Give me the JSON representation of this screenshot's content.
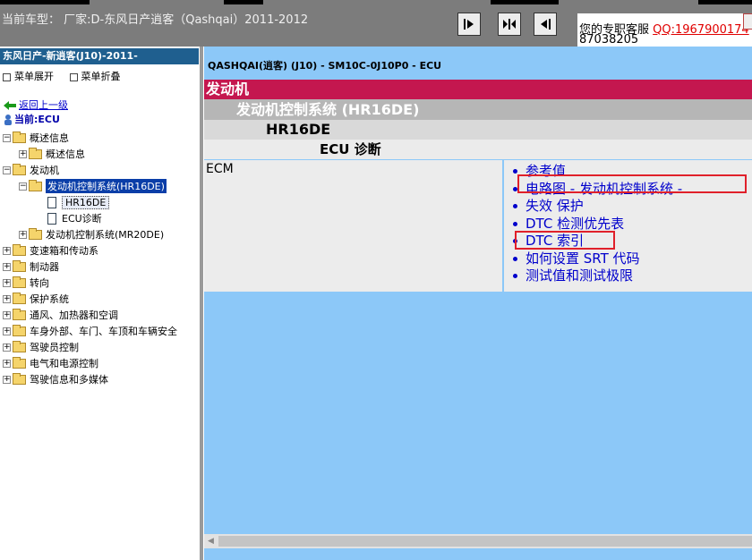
{
  "header": {
    "car_label": "当前车型： 厂家:D-东风日产逍客（Qashqai）2011-2012",
    "service_label": "您的专职客服 ",
    "service_qq": "QQ:1967900174",
    "service_number": "87038205"
  },
  "sidebar": {
    "model_header": "东风日产-新逍客(J10)-2011-",
    "expand_all": "菜单展开",
    "collapse_all": "菜单折叠",
    "back_link": "返回上一级",
    "current": "当前:ECU",
    "tree": [
      {
        "label": "概述信息",
        "level": 0,
        "expander": "−",
        "icon": "folder"
      },
      {
        "label": "概述信息",
        "level": 1,
        "expander": "+",
        "icon": "folder"
      },
      {
        "label": "发动机",
        "level": 0,
        "expander": "−",
        "icon": "folder"
      },
      {
        "label": "发动机控制系统(HR16DE)",
        "level": 1,
        "expander": "−",
        "icon": "folder-open",
        "selected": true
      },
      {
        "label": "HR16DE",
        "level": 2,
        "expander": "",
        "icon": "document",
        "boxed": true
      },
      {
        "label": "ECU诊断",
        "level": 2,
        "expander": "",
        "icon": "document"
      },
      {
        "label": "发动机控制系统(MR20DE)",
        "level": 1,
        "expander": "+",
        "icon": "folder"
      },
      {
        "label": "变速箱和传动系",
        "level": 0,
        "expander": "+",
        "icon": "folder"
      },
      {
        "label": "制动器",
        "level": 0,
        "expander": "+",
        "icon": "folder"
      },
      {
        "label": "转向",
        "level": 0,
        "expander": "+",
        "icon": "folder"
      },
      {
        "label": "保护系统",
        "level": 0,
        "expander": "+",
        "icon": "folder"
      },
      {
        "label": "通风、加热器和空调",
        "level": 0,
        "expander": "+",
        "icon": "folder"
      },
      {
        "label": "车身外部、车门、车顶和车辆安全",
        "level": 0,
        "expander": "+",
        "icon": "folder"
      },
      {
        "label": "驾驶员控制",
        "level": 0,
        "expander": "+",
        "icon": "folder"
      },
      {
        "label": "电气和电源控制",
        "level": 0,
        "expander": "+",
        "icon": "folder"
      },
      {
        "label": "驾驶信息和多媒体",
        "level": 0,
        "expander": "+",
        "icon": "folder"
      }
    ]
  },
  "main": {
    "path": "QASHQAI(逍客) (J10) - SM10C-0J10P0 - ECU",
    "section": "发动机",
    "system": "发动机控制系统 (HR16DE)",
    "model": "HR16DE",
    "diagnosis": "ECU 诊断",
    "ecm": "ECM",
    "links": [
      "参考值",
      "电路图 - 发动机控制系统 -",
      "失效 保护",
      "DTC 检测优先表",
      "DTC 索引",
      "如何设置 SRT 代码",
      "测试值和测试极限"
    ],
    "highlighted_links": [
      "电路图 - 发动机控制系统 -",
      "DTC 索引"
    ],
    "colors": {
      "section_bar": "#c4174f",
      "content_bg": "#8cc8f8",
      "highlight": "#e0202a",
      "link": "#0000cc"
    }
  }
}
